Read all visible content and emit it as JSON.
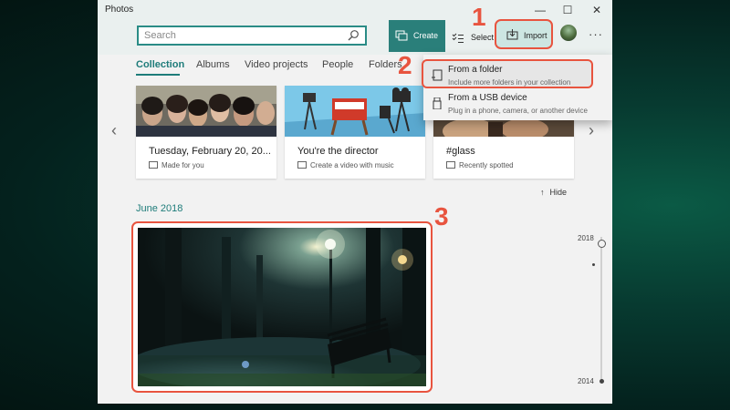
{
  "window": {
    "title": "Photos",
    "controls": {
      "minimize": "—",
      "maximize": "☐",
      "close": "✕"
    }
  },
  "toolbar": {
    "search_placeholder": "Search",
    "create_label": "Create",
    "select_label": "Select",
    "import_label": "Import",
    "more_label": "···"
  },
  "tabs": [
    "Collection",
    "Albums",
    "Video projects",
    "People",
    "Folders"
  ],
  "cards": [
    {
      "title": "Tuesday, February 20, 20...",
      "subtitle": "Made for you"
    },
    {
      "title": "You're the director",
      "subtitle": "Create a video with music"
    },
    {
      "title": "#glass",
      "subtitle": "Recently spotted"
    }
  ],
  "carousel": {
    "prev": "‹",
    "next": "›"
  },
  "import_menu": {
    "items": [
      {
        "title": "From a folder",
        "subtitle": "Include more folders in your collection"
      },
      {
        "title": "From a USB device",
        "subtitle": "Plug in a phone, camera, or another device"
      }
    ]
  },
  "hide_label": "Hide",
  "month_label": "June 2018",
  "timeline": {
    "top_year": "2018",
    "bottom_year": "2014"
  },
  "annotations": [
    "1",
    "2",
    "3"
  ],
  "colors": {
    "accent": "#1e7c7a",
    "highlight": "#e8543f",
    "create_bg": "#2a7f7a"
  }
}
